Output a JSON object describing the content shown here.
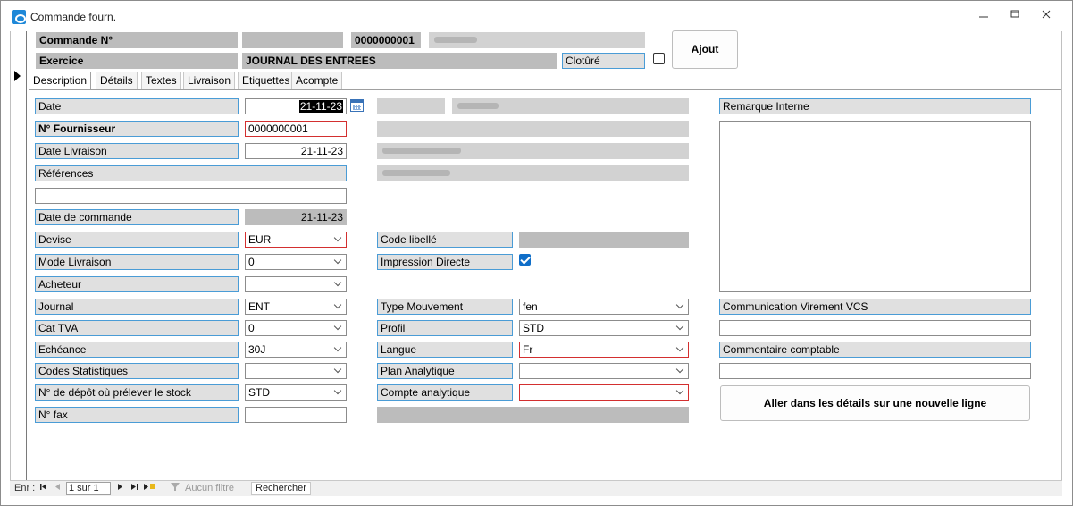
{
  "window": {
    "title": "Commande fourn.",
    "minimize": "🗕",
    "restore": "🗗",
    "close": "✕"
  },
  "header": {
    "commande_label": "Commande N°",
    "commande_number": "0000000001",
    "exercice_label": "Exercice",
    "journal_title": "JOURNAL DES ENTREES",
    "cloture_label": "Clotûré",
    "cloture_checked": false,
    "ajout_button": "Ajout"
  },
  "tabs": [
    {
      "label": "Description",
      "active": true
    },
    {
      "label": "Détails",
      "active": false
    },
    {
      "label": "Textes",
      "active": false
    },
    {
      "label": "Livraison",
      "active": false
    },
    {
      "label": "Etiquettes",
      "active": false
    },
    {
      "label": "Acompte",
      "active": false
    }
  ],
  "form": {
    "date_label": "Date",
    "date_value": "21-11-23",
    "fournisseur_label": "N° Fournisseur",
    "fournisseur_value": "0000000001",
    "date_livraison_label": "Date Livraison",
    "date_livraison_value": "21-11-23",
    "references_label": "Références",
    "references_value": "",
    "date_commande_label": "Date de commande",
    "date_commande_value": "21-11-23",
    "devise_label": "Devise",
    "devise_value": "EUR",
    "mode_livraison_label": "Mode Livraison",
    "mode_livraison_value": "0",
    "acheteur_label": "Acheteur",
    "acheteur_value": "",
    "journal_label": "Journal",
    "journal_value": "ENT",
    "cat_tva_label": "Cat TVA",
    "cat_tva_value": "0",
    "echeance_label": "Echéance",
    "echeance_value": "30J",
    "codes_stat_label": "Codes Statistiques",
    "codes_stat_value": "",
    "depot_label": "N° de dépôt où prélever le stock",
    "depot_value": "STD",
    "fax_label": "N° fax",
    "fax_value": ""
  },
  "middle": {
    "code_libelle_label": "Code libellé",
    "impression_label": "Impression Directe",
    "impression_checked": true,
    "type_mouvement_label": "Type Mouvement",
    "type_mouvement_value": "fen",
    "profil_label": "Profil",
    "profil_value": "STD",
    "langue_label": "Langue",
    "langue_value": "Fr",
    "plan_analytique_label": "Plan Analytique",
    "plan_analytique_value": "",
    "compte_analytique_label": "Compte analytique",
    "compte_analytique_value": ""
  },
  "right": {
    "remarque_label": "Remarque Interne",
    "communication_label": "Communication Virement VCS",
    "commentaire_label": "Commentaire comptable",
    "details_button": "Aller dans les détails sur une nouvelle ligne"
  },
  "navbar": {
    "enr_label": "Enr :",
    "first": "⏮",
    "prev": "◀",
    "record": "1 sur 1",
    "next": "▶",
    "last": "⏭",
    "new": "▶✱",
    "filter": "Aucun filtre",
    "search": "Rechercher"
  },
  "colors": {
    "label_border": "#4a9cd6",
    "label_bg": "#e0e0e0",
    "readonly_bg": "#bcbcbc",
    "error_border": "#d32f2f",
    "checkbox_checked": "#0f6ec8"
  }
}
